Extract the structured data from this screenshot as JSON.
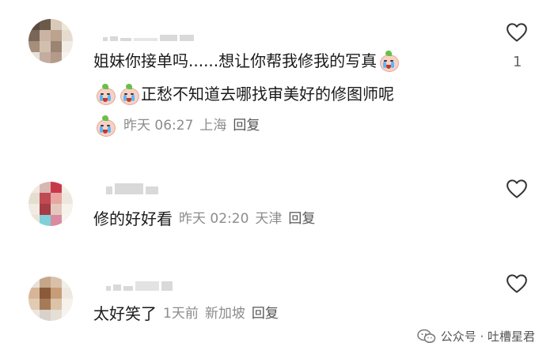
{
  "comments": [
    {
      "text_line1": "姐妹你接单吗......想让你帮我修我的写真",
      "text_line2": "正愁不知道去哪找审美好的修图师呢",
      "time": "昨天 06:27",
      "location": "上海",
      "reply": "回复",
      "like_count": "1"
    },
    {
      "text": "修的好好看",
      "time": "昨天 02:20",
      "location": "天津",
      "reply": "回复"
    },
    {
      "text": "太好笑了",
      "time": "1天前",
      "location": "新加坡",
      "reply": "回复"
    }
  ],
  "icons": {
    "like": "heart-outline-icon",
    "emoji": "crying-peach-emoji-icon",
    "wechat": "wechat-logo-icon"
  },
  "watermark": "公众号 · 吐槽星君"
}
